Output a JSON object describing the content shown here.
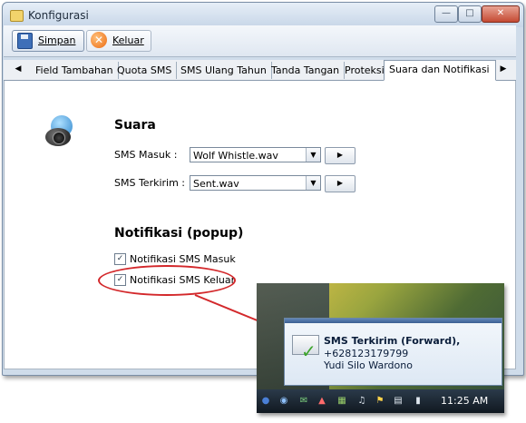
{
  "window": {
    "title": "Konfigurasi"
  },
  "toolbar": {
    "save_label": "Simpan",
    "exit_label": "Keluar"
  },
  "tabs": [
    {
      "label": "Field Tambahan"
    },
    {
      "label": "Quota SMS"
    },
    {
      "label": "SMS Ulang Tahun"
    },
    {
      "label": "Tanda Tangan"
    },
    {
      "label": "Proteksi"
    },
    {
      "label": "Suara dan Notifikasi"
    }
  ],
  "active_tab": "Suara dan Notifikasi",
  "sound": {
    "heading": "Suara",
    "incoming_label": "SMS Masuk :",
    "incoming_value": "Wolf Whistle.wav",
    "sent_label": "SMS Terkirim :",
    "sent_value": "Sent.wav"
  },
  "notification": {
    "heading": "Notifikasi (popup)",
    "incoming_label": "Notifikasi SMS Masuk",
    "incoming_checked": true,
    "outgoing_label": "Notifikasi SMS Keluar",
    "outgoing_checked": true
  },
  "popup": {
    "title": "SMS Terkirim (Forward),",
    "number": "+628123179799",
    "name": "Yudi Silo Wardono"
  },
  "taskbar": {
    "time": "11:25 AM"
  },
  "colors": {
    "callout": "#d3282b",
    "accent": "#3c5f91"
  }
}
